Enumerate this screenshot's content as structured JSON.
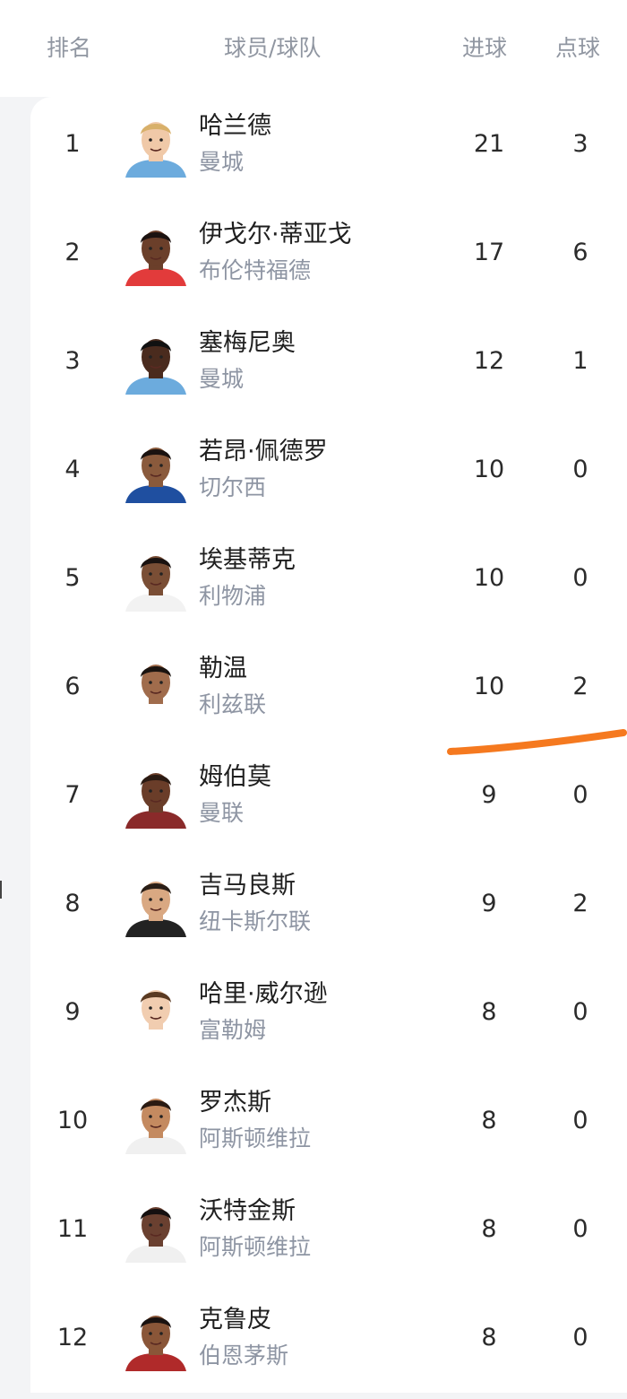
{
  "header": {
    "rank_label": "排名",
    "player_label": "球员/球队",
    "goals_label": "进球",
    "penalties_label": "点球"
  },
  "players": [
    {
      "rank": "1",
      "name": "哈兰德",
      "team": "曼城",
      "goals": "21",
      "penalties": "3",
      "skin": "#f0c9a8",
      "hair": "#d8b06a",
      "kit": "#6cabdd"
    },
    {
      "rank": "2",
      "name": "伊戈尔·蒂亚戈",
      "team": "布伦特福德",
      "goals": "17",
      "penalties": "6",
      "skin": "#6b3f2a",
      "hair": "#1b1210",
      "kit": "#e23b3b"
    },
    {
      "rank": "3",
      "name": "塞梅尼奥",
      "team": "曼城",
      "goals": "12",
      "penalties": "1",
      "skin": "#4a2b1e",
      "hair": "#111111",
      "kit": "#6cabdd"
    },
    {
      "rank": "4",
      "name": "若昂·佩德罗",
      "team": "切尔西",
      "goals": "10",
      "penalties": "0",
      "skin": "#8a5a3c",
      "hair": "#1a1210",
      "kit": "#1f4fa0"
    },
    {
      "rank": "5",
      "name": "埃基蒂克",
      "team": "利物浦",
      "goals": "10",
      "penalties": "0",
      "skin": "#7a4e35",
      "hair": "#1a1210",
      "kit": "#f2f2f2"
    },
    {
      "rank": "6",
      "name": "勒温",
      "team": "利兹联",
      "goals": "10",
      "penalties": "2",
      "skin": "#a06c4c",
      "hair": "#1b1410",
      "kit": "#ffffff"
    },
    {
      "rank": "7",
      "name": "姆伯莫",
      "team": "曼联",
      "goals": "9",
      "penalties": "0",
      "skin": "#6a3d29",
      "hair": "#2a1a12",
      "kit": "#8a2a2a"
    },
    {
      "rank": "8",
      "name": "吉马良斯",
      "team": "纽卡斯尔联",
      "goals": "9",
      "penalties": "2",
      "skin": "#d9a882",
      "hair": "#2a1e16",
      "kit": "#222222"
    },
    {
      "rank": "9",
      "name": "哈里·威尔逊",
      "team": "富勒姆",
      "goals": "8",
      "penalties": "0",
      "skin": "#f1cdb0",
      "hair": "#5a3a22",
      "kit": "#ffffff"
    },
    {
      "rank": "10",
      "name": "罗杰斯",
      "team": "阿斯顿维拉",
      "goals": "8",
      "penalties": "0",
      "skin": "#c48a60",
      "hair": "#2a1a12",
      "kit": "#f0f0f0"
    },
    {
      "rank": "11",
      "name": "沃特金斯",
      "team": "阿斯顿维拉",
      "goals": "8",
      "penalties": "0",
      "skin": "#6a4030",
      "hair": "#151010",
      "kit": "#f0f0f0"
    },
    {
      "rank": "12",
      "name": "克鲁皮",
      "team": "伯恩茅斯",
      "goals": "8",
      "penalties": "0",
      "skin": "#8a5638",
      "hair": "#1a1210",
      "kit": "#b02a2a"
    }
  ],
  "annotation_color": "#f5791f"
}
